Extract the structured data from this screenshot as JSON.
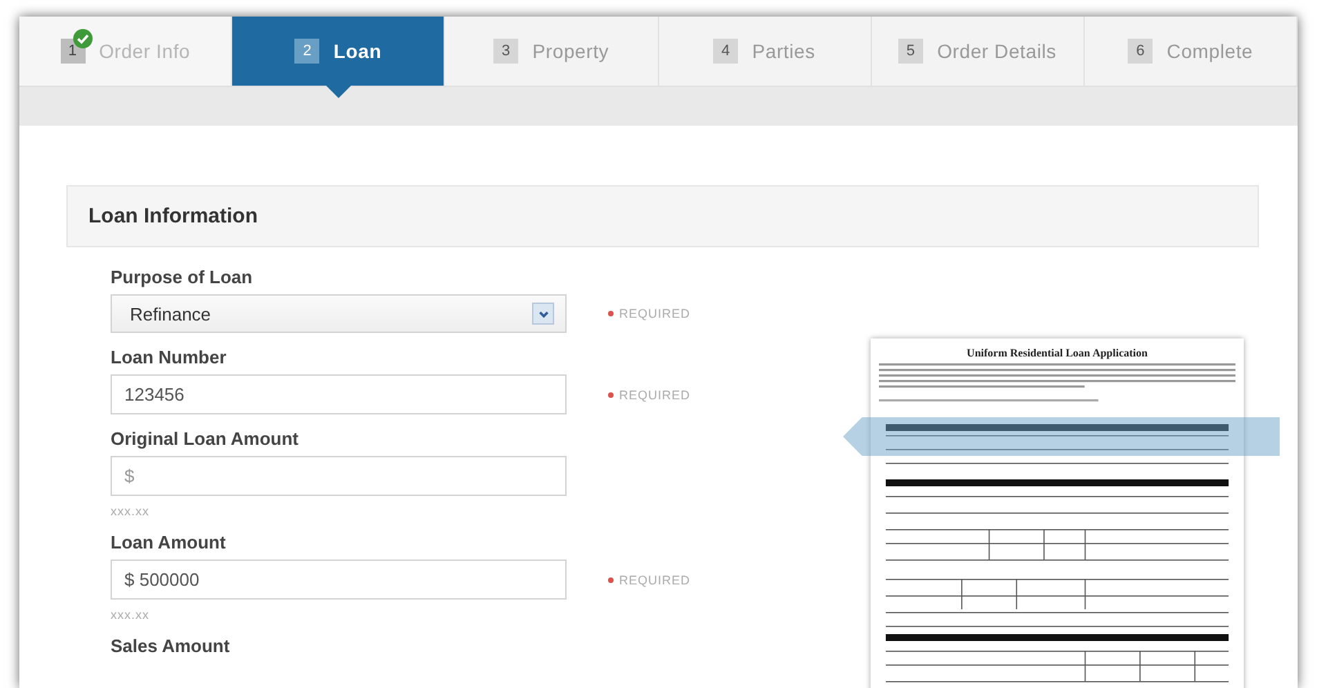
{
  "tabs": [
    {
      "number": "1",
      "label": "Order Info",
      "selected": false,
      "completed": true
    },
    {
      "number": "2",
      "label": "Loan",
      "selected": true,
      "completed": false
    },
    {
      "number": "3",
      "label": "Property",
      "selected": false,
      "completed": false
    },
    {
      "number": "4",
      "label": "Parties",
      "selected": false,
      "completed": false
    },
    {
      "number": "5",
      "label": "Order Details",
      "selected": false,
      "completed": false
    },
    {
      "number": "6",
      "label": "Complete",
      "selected": false,
      "completed": false
    }
  ],
  "section": {
    "title": "Loan Information",
    "fields": [
      {
        "kind": "select",
        "label": "Purpose of Loan",
        "value": "Refinance",
        "required_note": "REQUIRED"
      },
      {
        "kind": "input",
        "label": "Loan Number",
        "value": "123456",
        "required_note": "REQUIRED"
      },
      {
        "kind": "input",
        "label": "Original Loan Amount",
        "placeholder": "$",
        "hint": "xxx.xx"
      },
      {
        "kind": "input",
        "label": "Loan Amount",
        "value": "$ 500000",
        "required_note": "REQUIRED",
        "hint": "xxx.xx"
      },
      {
        "kind": "label",
        "label": "Sales Amount"
      }
    ]
  },
  "document": {
    "title": "Uniform Residential Loan Application"
  }
}
